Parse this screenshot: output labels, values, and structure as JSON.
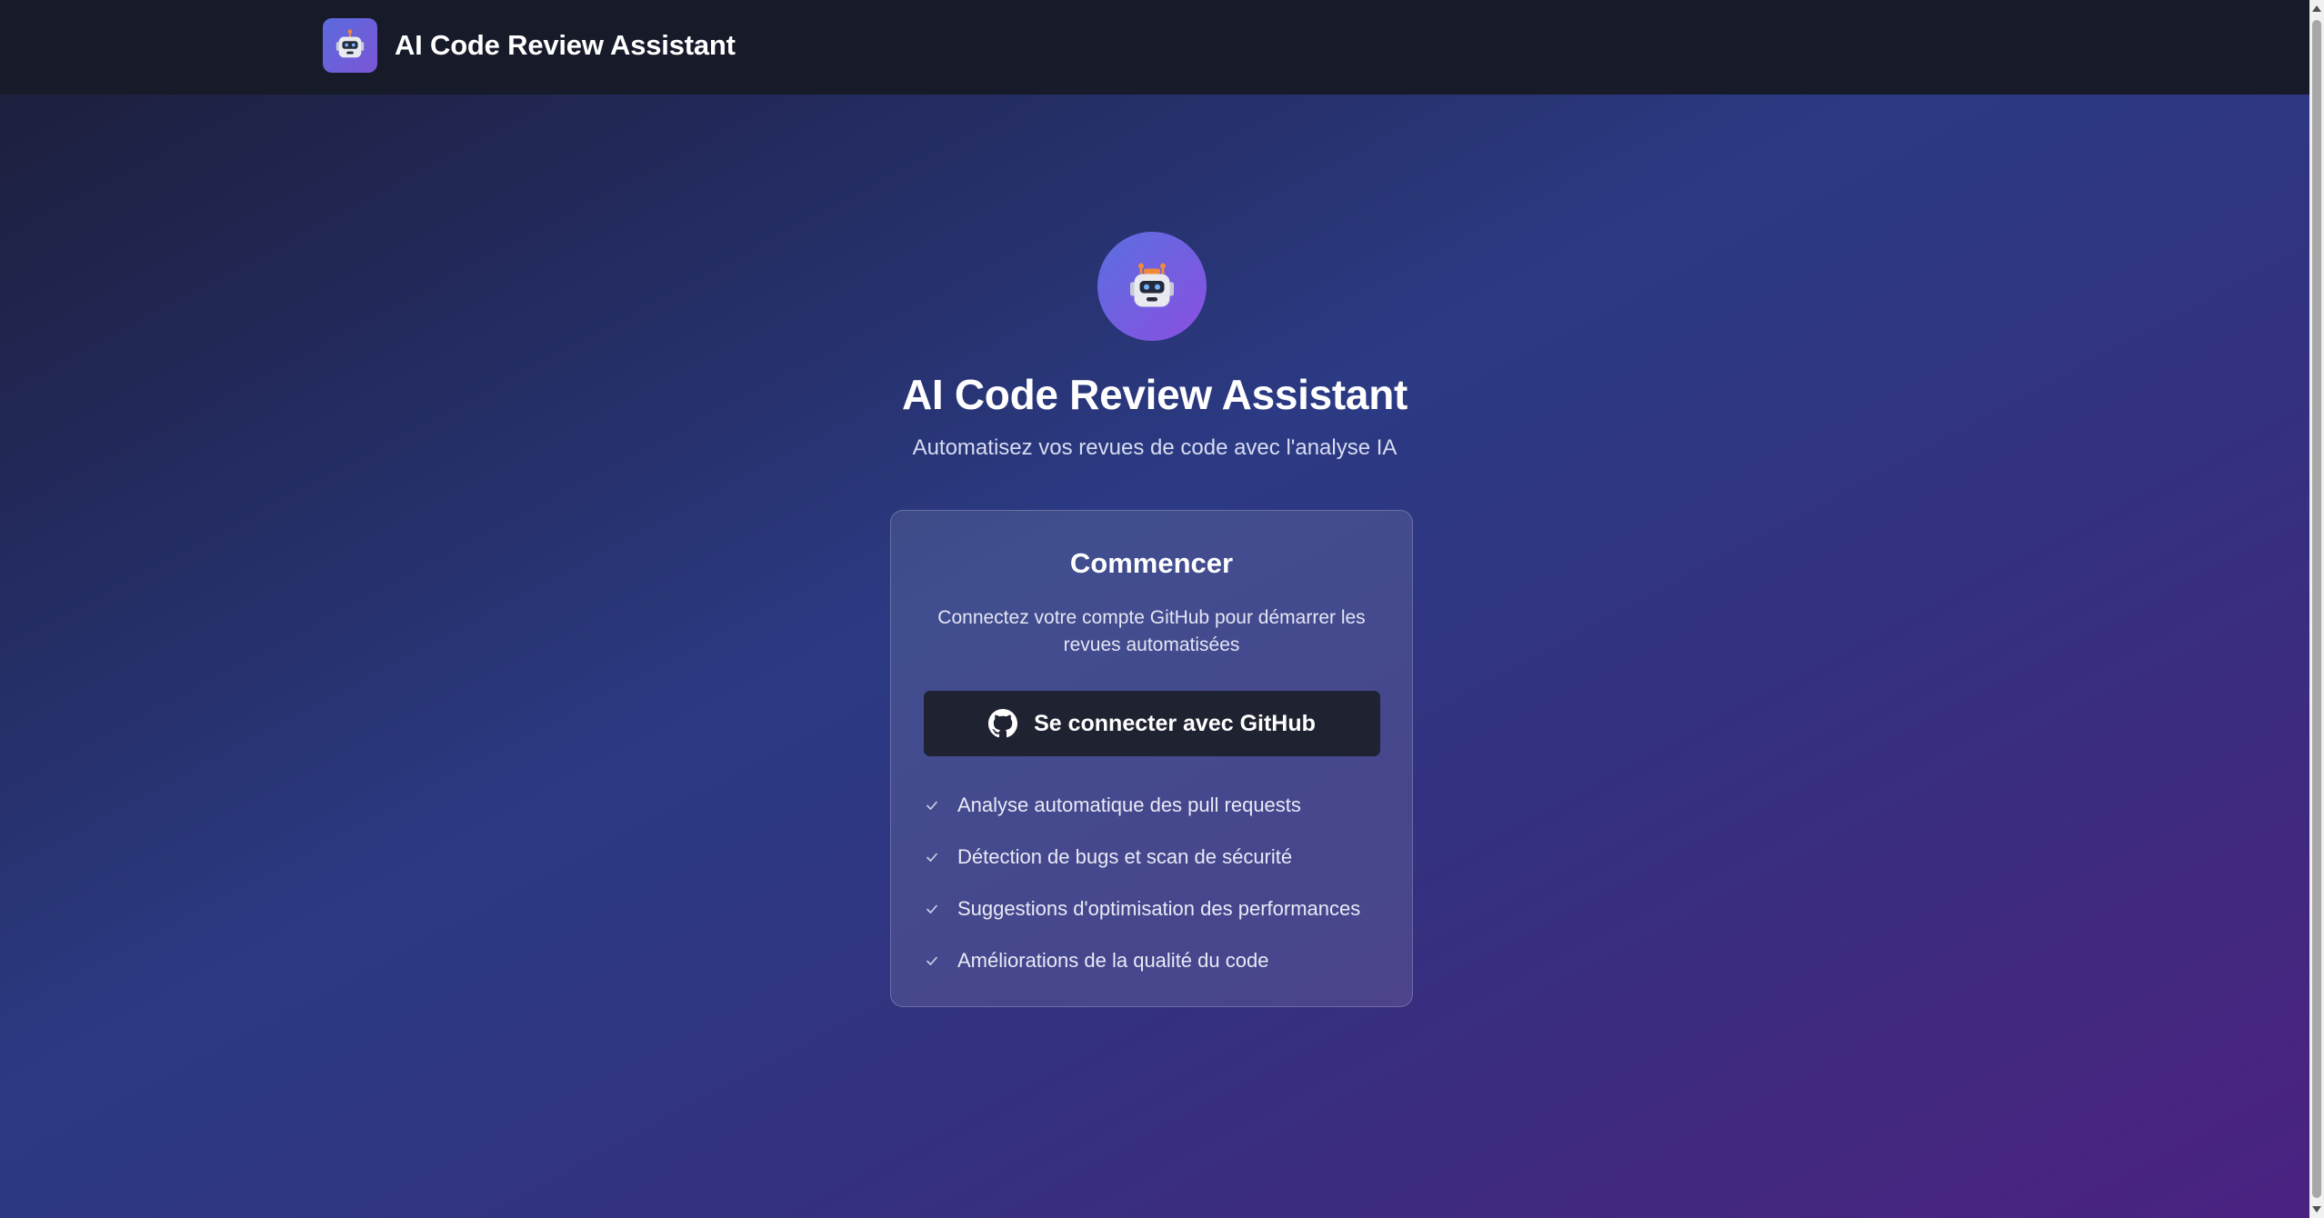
{
  "header": {
    "brand_title": "AI Code Review Assistant",
    "logo_icon": "robot-icon"
  },
  "hero": {
    "avatar_icon": "robot-icon",
    "title": "AI Code Review Assistant",
    "subtitle": "Automatisez vos revues de code avec l'analyse IA"
  },
  "card": {
    "title": "Commencer",
    "description": "Connectez votre compte GitHub pour démarrer les revues automatisées",
    "github_button_label": "Se connecter avec GitHub",
    "github_icon": "github-icon",
    "features": [
      "Analyse automatique des pull requests",
      "Détection de bugs et scan de sécurité",
      "Suggestions d'optimisation des performances",
      "Améliorations de la qualité du code"
    ],
    "feature_icon": "check-icon"
  },
  "colors": {
    "header_bg": "#161a29",
    "accent_gradient_start": "#5a6fe0",
    "accent_gradient_end": "#8a4fe0",
    "button_bg": "#1f2230"
  }
}
